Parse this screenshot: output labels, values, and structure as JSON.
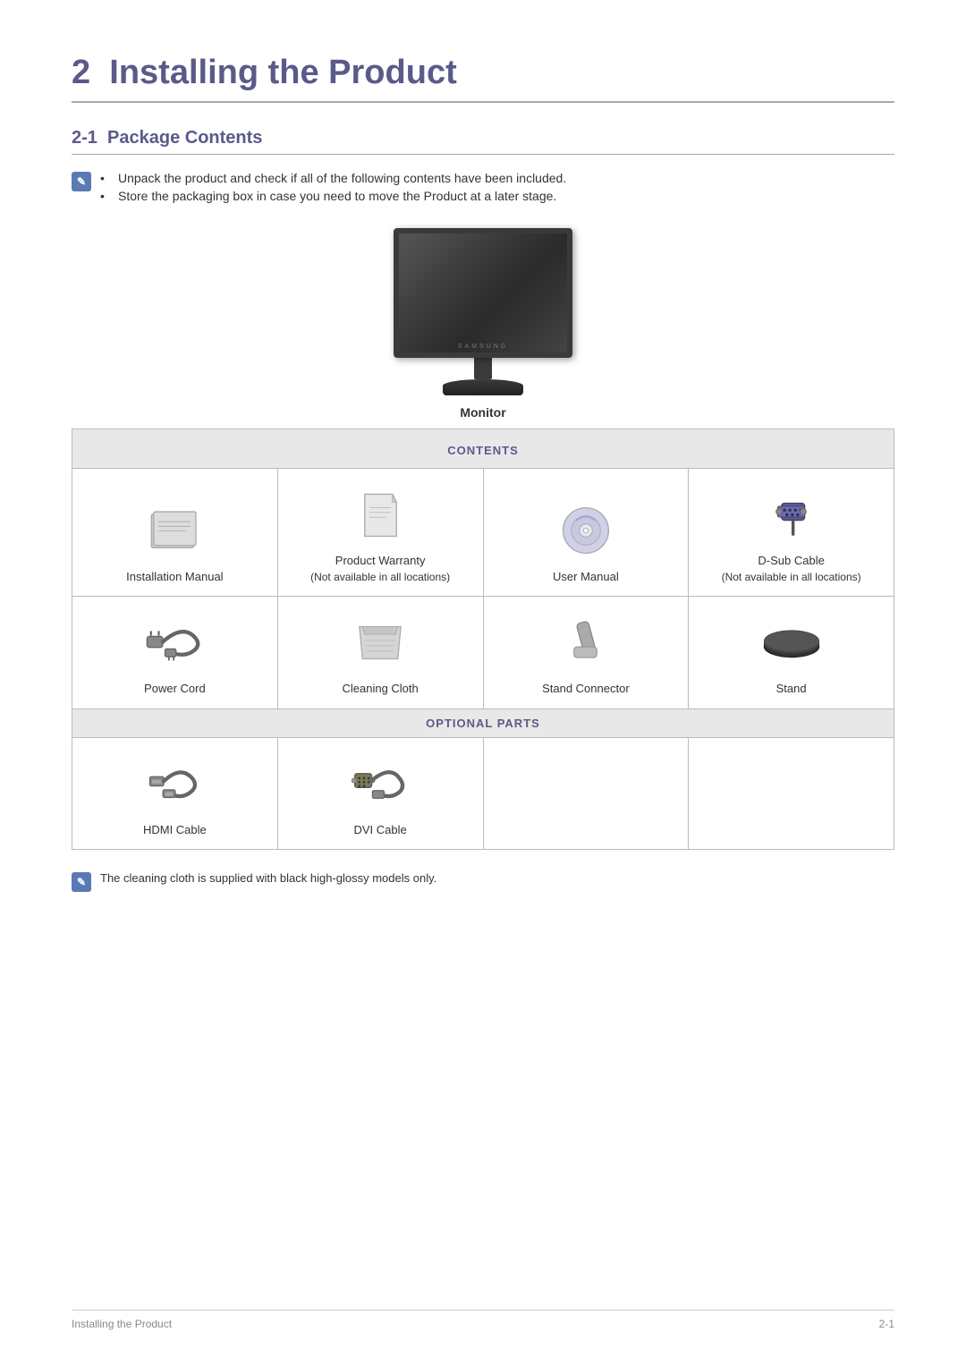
{
  "page": {
    "chapter_number": "2",
    "chapter_title": "Installing the Product",
    "section_number": "2-1",
    "section_title": "Package Contents",
    "notes": [
      "Unpack the product and check if all of the following contents have been included.",
      "Store the packaging box in case you need to move the Product at a later stage."
    ],
    "monitor_label": "Monitor",
    "contents_header": "CONTENTS",
    "optional_header": "OPTIONAL PARTS",
    "contents_items": [
      {
        "label": "Installation Manual",
        "icon": "manual"
      },
      {
        "label": "Product Warranty\n(Not available in all locations)",
        "icon": "warranty"
      },
      {
        "label": "User Manual",
        "icon": "cd"
      },
      {
        "label": "D-Sub Cable\n(Not available in all locations)",
        "icon": "dsub"
      },
      {
        "label": "Power Cord",
        "icon": "powercord"
      },
      {
        "label": "Cleaning Cloth",
        "icon": "cloth"
      },
      {
        "label": "Stand Connector",
        "icon": "standconnector"
      },
      {
        "label": "Stand",
        "icon": "stand"
      }
    ],
    "optional_items": [
      {
        "label": "HDMI Cable",
        "icon": "hdmi"
      },
      {
        "label": "DVI Cable",
        "icon": "dvi"
      },
      {
        "label": "",
        "icon": ""
      },
      {
        "label": "",
        "icon": ""
      }
    ],
    "footer_note": "The cleaning cloth is supplied with black high-glossy models only.",
    "footer_left": "Installing the Product",
    "footer_right": "2-1"
  }
}
